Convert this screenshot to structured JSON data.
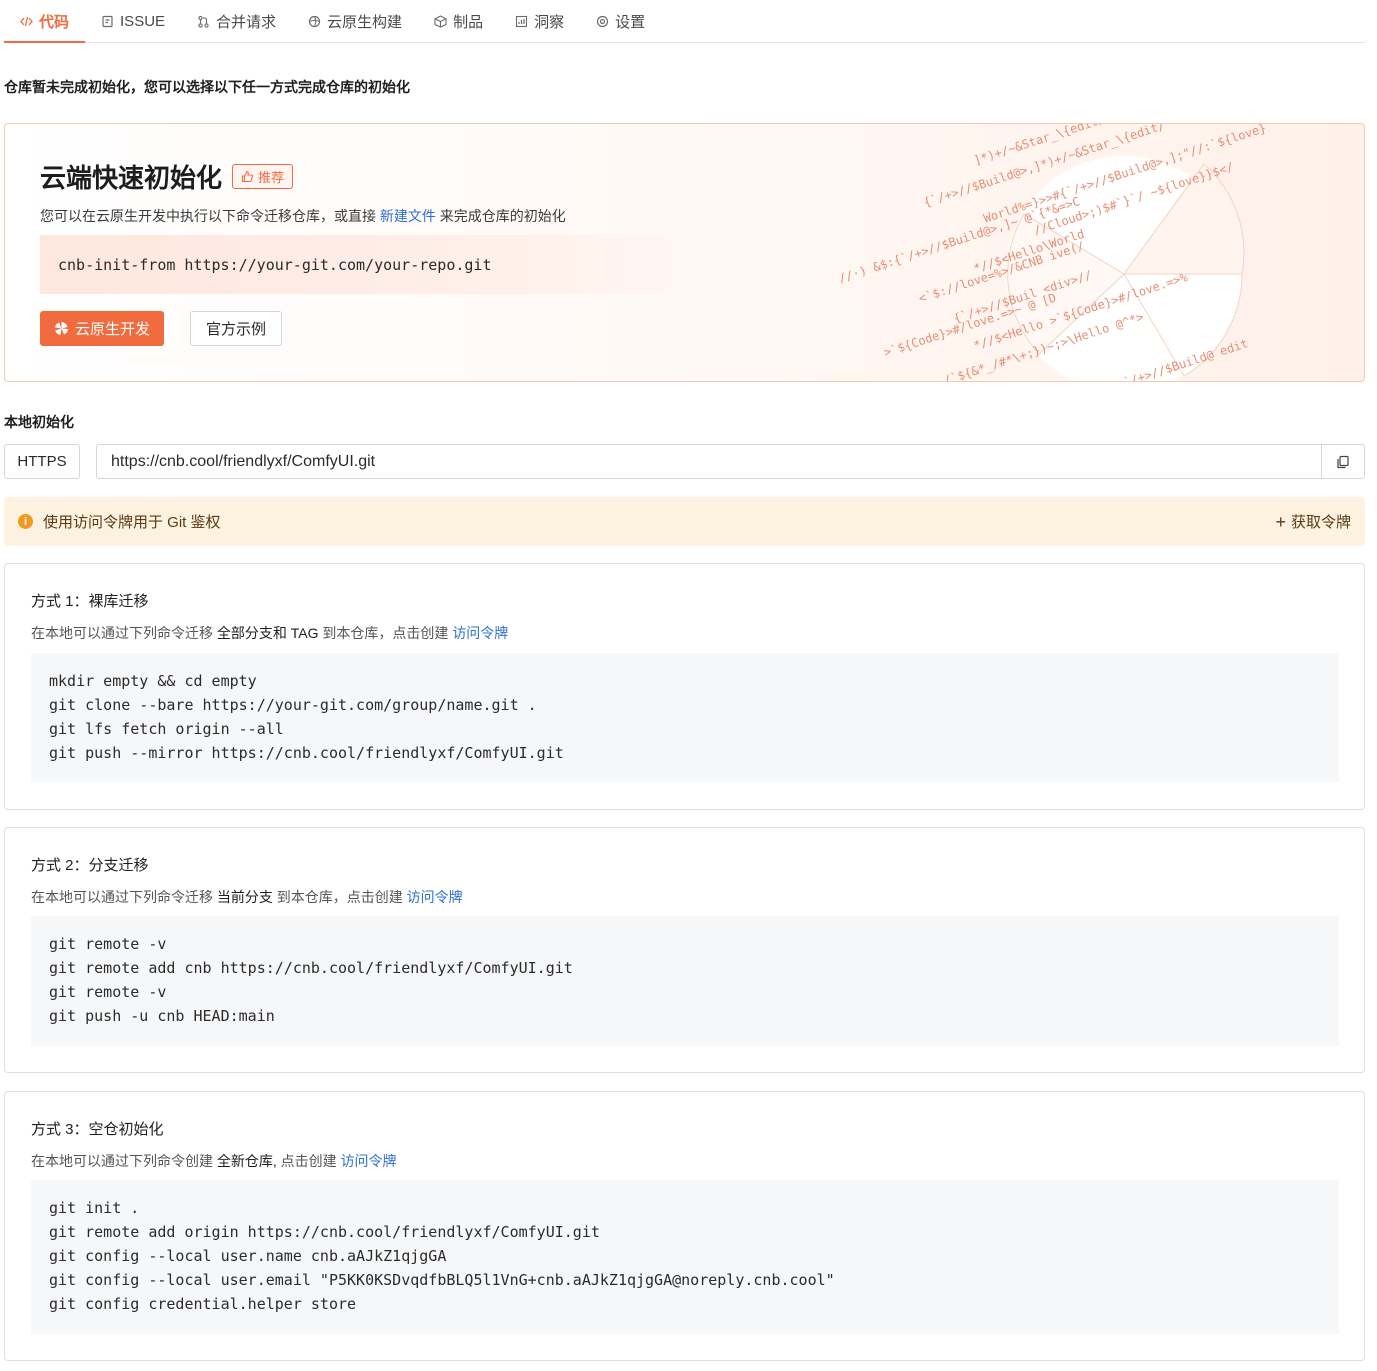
{
  "tabs": [
    {
      "label": "代码",
      "icon": "code-icon",
      "active": true
    },
    {
      "label": "ISSUE",
      "icon": "issue-icon",
      "active": false
    },
    {
      "label": "合并请求",
      "icon": "merge-request-icon",
      "active": false
    },
    {
      "label": "云原生构建",
      "icon": "build-icon",
      "active": false
    },
    {
      "label": "制品",
      "icon": "package-icon",
      "active": false
    },
    {
      "label": "洞察",
      "icon": "insight-icon",
      "active": false
    },
    {
      "label": "设置",
      "icon": "gear-icon",
      "active": false
    }
  ],
  "notice": "仓库暂未完成初始化，您可以选择以下任一方式完成仓库的初始化",
  "cloud": {
    "title": "云端快速初始化",
    "badge": "推荐",
    "desc_prefix": "您可以在云原生开发中执行以下命令迁移仓库，或直接",
    "desc_link": "新建文件",
    "desc_suffix": "来完成仓库的初始化",
    "command": "cnb-init-from https://your-git.com/your-repo.git",
    "primary_button": "云原生开发",
    "secondary_button": "官方示例"
  },
  "local": {
    "title": "本地初始化",
    "protocol": "HTTPS",
    "url": "https://cnb.cool/friendlyxf/ComfyUI.git"
  },
  "token_bar": {
    "text": "使用访问令牌用于 Git 鉴权",
    "action": "获取令牌"
  },
  "methods": [
    {
      "title": "方式 1：裸库迁移",
      "desc_prefix": "在本地可以通过下列命令迁移",
      "desc_highlight": "全部分支和 TAG",
      "desc_middle": "到本仓库，点击创建",
      "desc_link": "访问令牌",
      "code": [
        "mkdir empty && cd empty",
        "git clone --bare https://your-git.com/group/name.git .",
        "git lfs fetch origin --all",
        "git push --mirror https://cnb.cool/friendlyxf/ComfyUI.git"
      ]
    },
    {
      "title": "方式 2：分支迁移",
      "desc_prefix": "在本地可以通过下列命令迁移",
      "desc_highlight": "当前分支",
      "desc_middle": "到本仓库，点击创建",
      "desc_link": "访问令牌",
      "code": [
        "git remote -v",
        "git remote add cnb https://cnb.cool/friendlyxf/ComfyUI.git",
        "git remote -v",
        "git push -u cnb HEAD:main"
      ]
    },
    {
      "title": "方式 3：空仓初始化",
      "desc_prefix": "在本地可以通过下列命令创建",
      "desc_highlight": "全新仓库,",
      "desc_middle": "点击创建",
      "desc_link": "访问令牌",
      "code": [
        "git init .",
        "git remote add origin https://cnb.cool/friendlyxf/ComfyUI.git",
        "git config --local user.name cnb.aAJkZ1qjgGA",
        "git config --local user.email \"P5KK0KSDvqdfbBLQ5l1VnG+cnb.aAJkZ1qjgGA@noreply.cnb.cool\"",
        "git config credential.helper store"
      ]
    }
  ],
  "deco_lines": [
    "]*)+/~&Star_\\{edit/",
    "{`/+>//$Build@>,]*)+/~&Star_\\{edit/",
    "World%=}>>#{`/+>//$Build@>,];\"//:`${love}",
    "//Cloud>;)$#`}`/  ~${love}}$</",
    "//·) &$:{`/+>//$Build@>,]~ @`{*&=>C",
    "*//$<Hello\\World",
    "<`$://love=%>/&CNB   ive(/",
    "{`/+>//$Buil   <div>//",
    ">`${Code}>#/love.=>~ @   [D",
    "*//$<Hello   >`${Code}>#/love.=>%",
    "/`${&*_/#*\\+;})~;>\\Hello  @^*>",
    "`/+>//$Build@  edit"
  ],
  "colors": {
    "accent": "#f06b3e",
    "link": "#2f6fd6",
    "warning_bg": "#fdf2e0"
  }
}
